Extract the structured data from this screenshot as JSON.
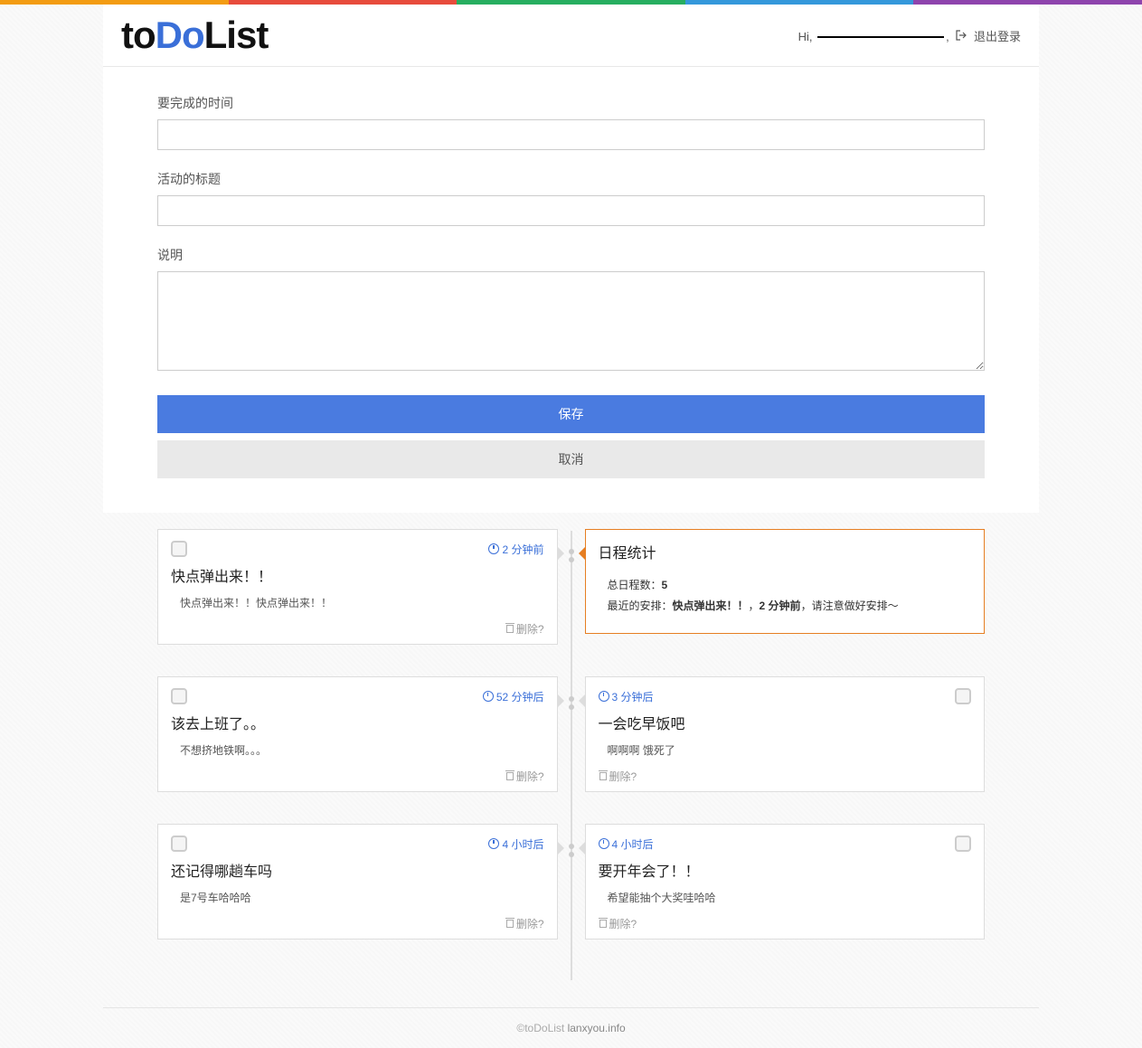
{
  "header": {
    "logo_parts": {
      "to": "to",
      "do": "Do",
      "list": "List"
    },
    "greeting": "Hi,",
    "logout_label": "退出登录"
  },
  "form": {
    "time_label": "要完成的时间",
    "time_value": "",
    "title_label": "活动的标题",
    "title_value": "",
    "desc_label": "说明",
    "desc_value": "",
    "save_label": "保存",
    "cancel_label": "取消"
  },
  "stats": {
    "title": "日程统计",
    "total_label": "总日程数：",
    "total_value": "5",
    "recent_label": "最近的安排：",
    "recent_title": "快点弹出来！！",
    "recent_sep": "，",
    "recent_time": "2 分钟前",
    "recent_suffix": "，请注意做好安排～"
  },
  "left_items": [
    {
      "time": "2 分钟前",
      "title": "快点弹出来！！",
      "desc": "快点弹出来！！快点弹出来！！",
      "delete_label": "删除?"
    },
    {
      "time": "52 分钟后",
      "title": "该去上班了。。",
      "desc": "不想挤地铁啊。。。",
      "delete_label": "删除?"
    },
    {
      "time": "4 小时后",
      "title": "还记得哪趟车吗",
      "desc": "是7号车哈哈哈",
      "delete_label": "删除?"
    }
  ],
  "right_items": [
    {
      "time": "3 分钟后",
      "title": "一会吃早饭吧",
      "desc": "啊啊啊 饿死了",
      "delete_label": "删除?"
    },
    {
      "time": "4 小时后",
      "title": "要开年会了！！",
      "desc": "希望能抽个大奖哇哈哈",
      "delete_label": "删除?"
    }
  ],
  "footer": {
    "copy": "©toDoList ",
    "link": "lanxyou.info"
  }
}
